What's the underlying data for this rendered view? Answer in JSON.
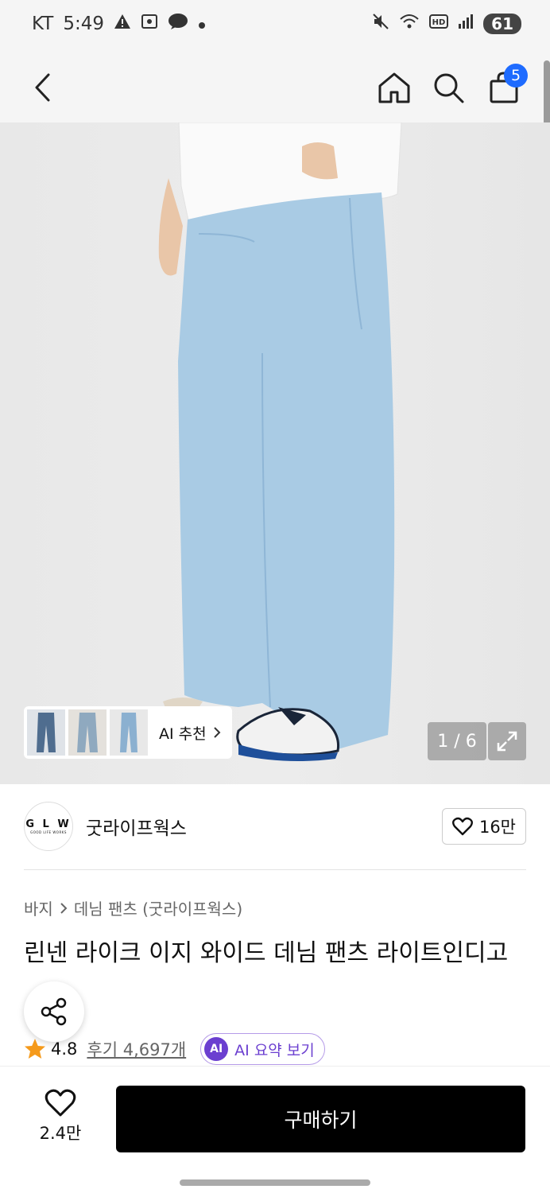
{
  "status": {
    "carrier": "KT",
    "time": "5:49",
    "battery": "61"
  },
  "nav": {
    "cart_count": "5"
  },
  "gallery": {
    "ai_recommend_label": "AI 추천",
    "counter": "1 / 6"
  },
  "brand": {
    "logo_text": "G L W",
    "logo_subtext": "GOOD LIFE WORKS",
    "name": "굿라이프웍스",
    "like_count": "16만"
  },
  "breadcrumb": {
    "category": "바지",
    "subcategory": "데님 팬츠 (굿라이프웍스)"
  },
  "product": {
    "title": "린넨 라이크 이지 와이드 데님 팬츠 라이트인디고",
    "rating": "4.8",
    "reviews": "후기 4,697개",
    "ai_badge": "AI",
    "ai_summary_label": "AI 요약 보기"
  },
  "bottom": {
    "wish_count": "2.4만",
    "buy_label": "구매하기"
  },
  "colors": {
    "accent_blue": "#1e6bff",
    "ai_purple": "#6b3fd0",
    "star": "#f59a1b",
    "buy_button": "#000000"
  }
}
